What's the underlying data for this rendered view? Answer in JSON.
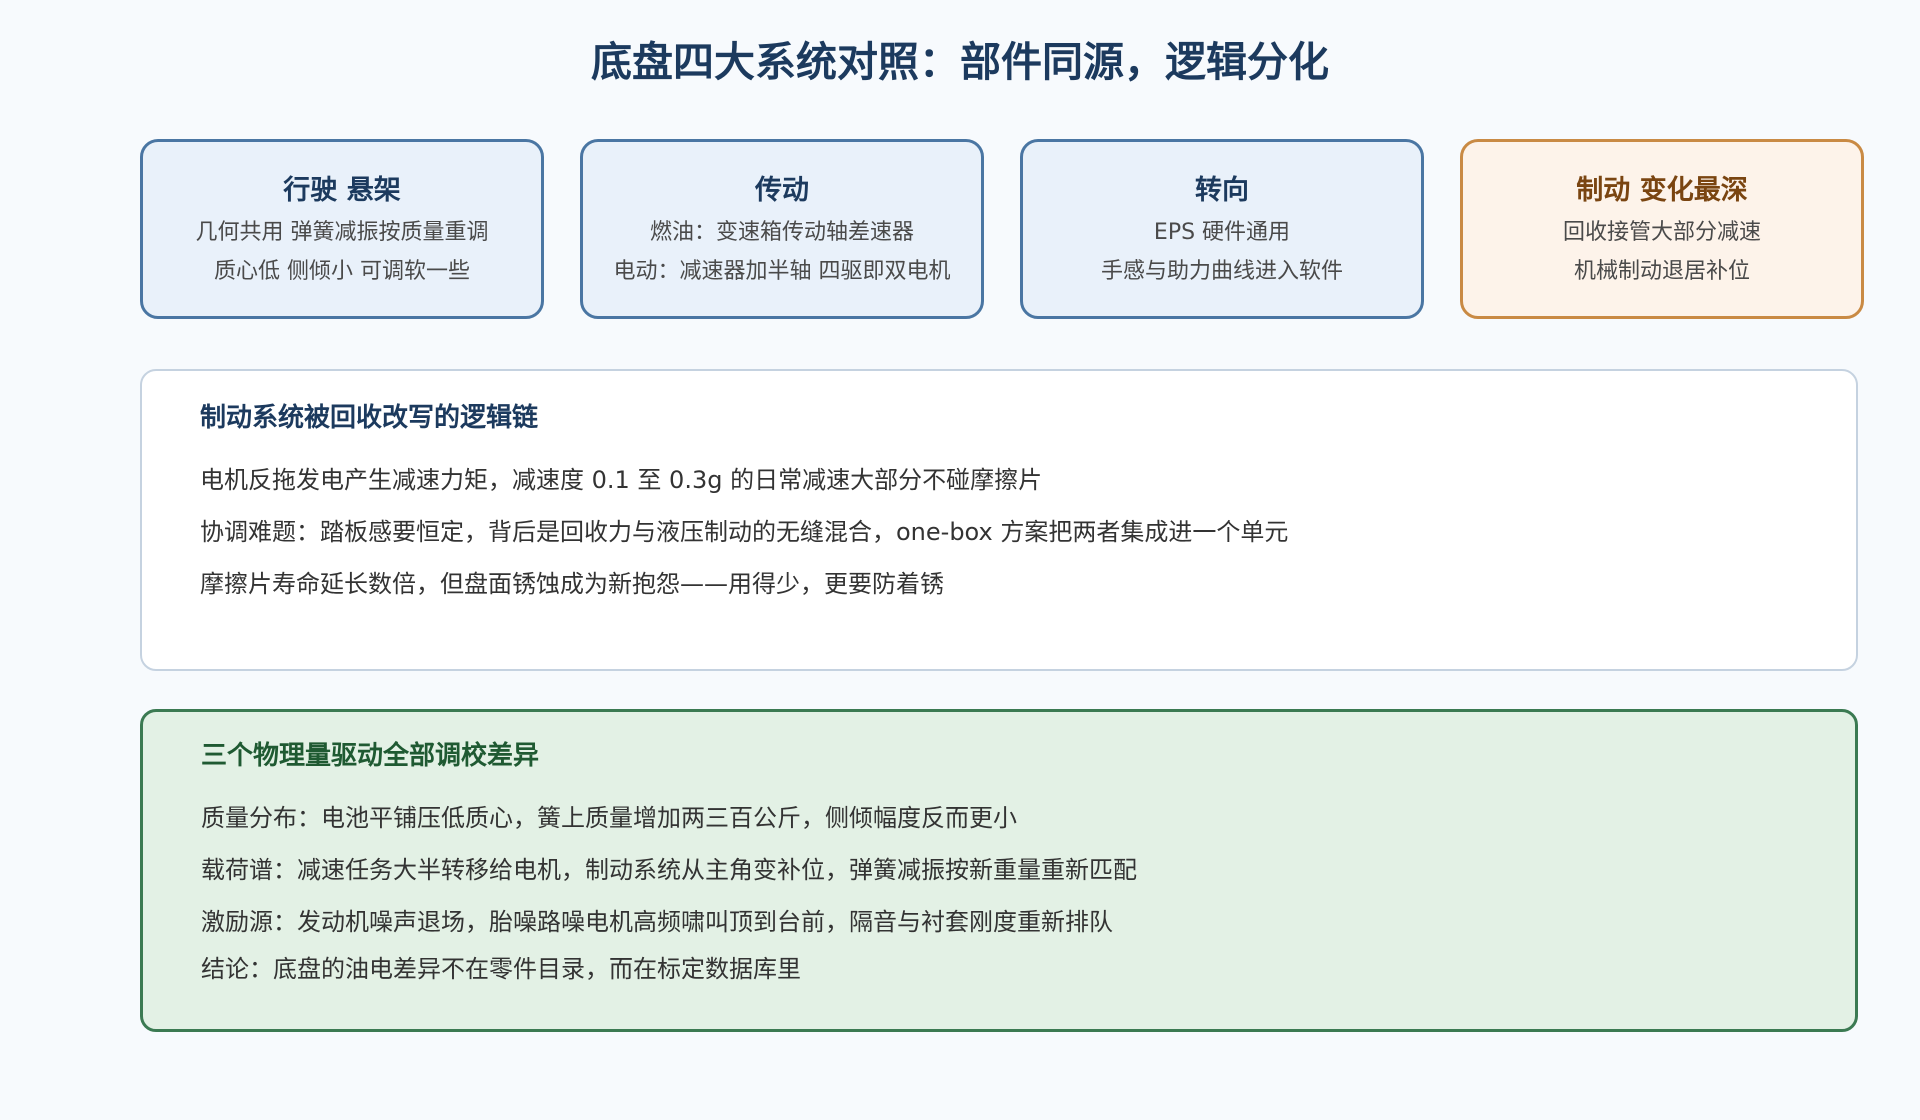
{
  "title": "底盘四大系统对照：部件同源，逻辑分化",
  "systems": [
    {
      "title": "行驶 悬架",
      "lines": [
        "几何共用 弹簧减振按质量重调",
        "质心低 侧倾小 可调软一些"
      ]
    },
    {
      "title": "传动",
      "lines": [
        "燃油：变速箱传动轴差速器",
        "电动：减速器加半轴 四驱即双电机"
      ]
    },
    {
      "title": "转向",
      "lines": [
        "EPS 硬件通用",
        "手感与助力曲线进入软件"
      ]
    },
    {
      "title": "制动 变化最深",
      "lines": [
        "回收接管大部分减速",
        "机械制动退居补位"
      ]
    }
  ],
  "braking_panel": {
    "title": "制动系统被回收改写的逻辑链",
    "lines": [
      "电机反拖发电产生减速力矩，减速度 0.1 至 0.3g 的日常减速大部分不碰摩擦片",
      "协调难题：踏板感要恒定，背后是回收力与液压制动的无缝混合，one-box 方案把两者集成进一个单元",
      "摩擦片寿命延长数倍，但盘面锈蚀成为新抱怨——用得少，更要防着锈"
    ]
  },
  "physics_panel": {
    "title": "三个物理量驱动全部调校差异",
    "lines": [
      "质量分布：电池平铺压低质心，簧上质量增加两三百公斤，侧倾幅度反而更小",
      "载荷谱：减速任务大半转移给电机，制动系统从主角变补位，弹簧减振按新重量重新匹配",
      "激励源：发动机噪声退场，胎噪路噪电机高频啸叫顶到台前，隔音与衬套刚度重新排队"
    ],
    "conclusion": "结论：底盘的油电差异不在零件目录，而在标定数据库里"
  },
  "colors": {
    "background": "#f7fafd",
    "title": "#1c3a5e",
    "card_border": "#4a76a3",
    "card_fill": "#e9f1fa",
    "highlight_border": "#c98a44",
    "highlight_fill": "#fdf3ea",
    "highlight_title": "#7a4511",
    "green_border": "#3b7a52",
    "green_fill": "#e3f1e5",
    "green_title": "#1f5a32"
  }
}
